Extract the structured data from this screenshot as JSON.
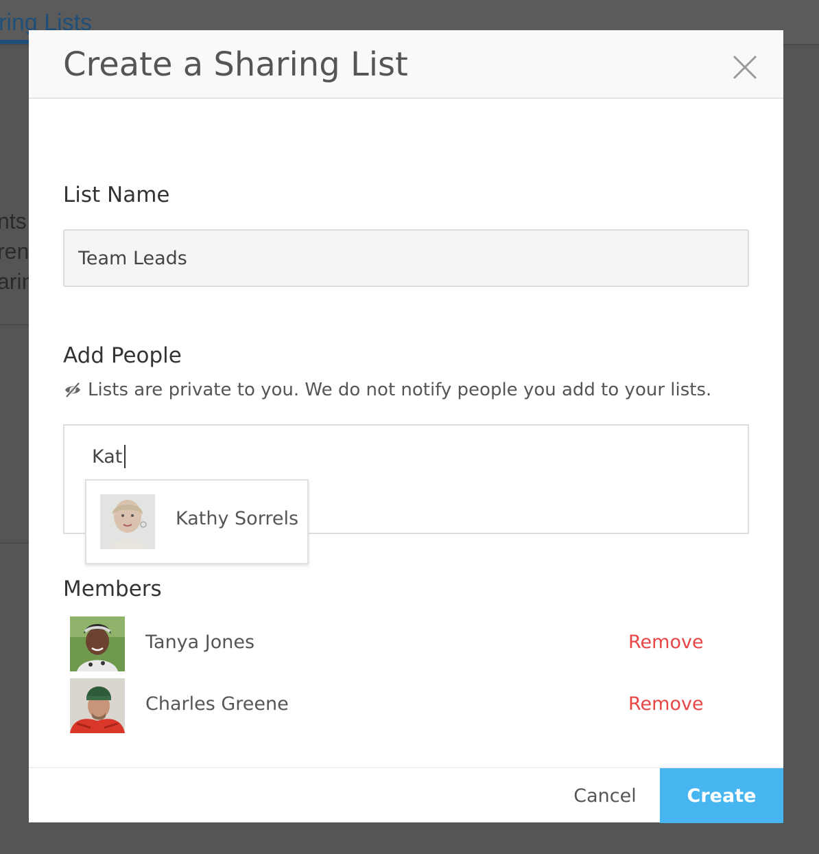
{
  "background": {
    "title_fragment": "ring Lists",
    "text_lines": [
      "nts",
      "ren",
      "arin"
    ]
  },
  "modal": {
    "title": "Create a Sharing List",
    "close_icon": "close-icon",
    "list_name": {
      "label": "List Name",
      "value": "Team Leads"
    },
    "add_people": {
      "label": "Add People",
      "privacy_icon": "eye-slash-icon",
      "note": "Lists are private to you. We do not notify people you add to your lists.",
      "query": "Kat",
      "suggestions": [
        {
          "name": "Kathy Sorrels",
          "avatar": "avatar-photo"
        }
      ]
    },
    "members": {
      "label": "Members",
      "items": [
        {
          "name": "Tanya Jones",
          "action": "Remove",
          "avatar": "avatar-photo"
        },
        {
          "name": "Charles Greene",
          "action": "Remove",
          "avatar": "avatar-photo"
        }
      ]
    },
    "footer": {
      "cancel_label": "Cancel",
      "create_label": "Create"
    }
  },
  "colors": {
    "overlay": "#555555",
    "accent": "#47b6f0",
    "danger": "#e84545",
    "header_bg": "#f9f9f9"
  }
}
